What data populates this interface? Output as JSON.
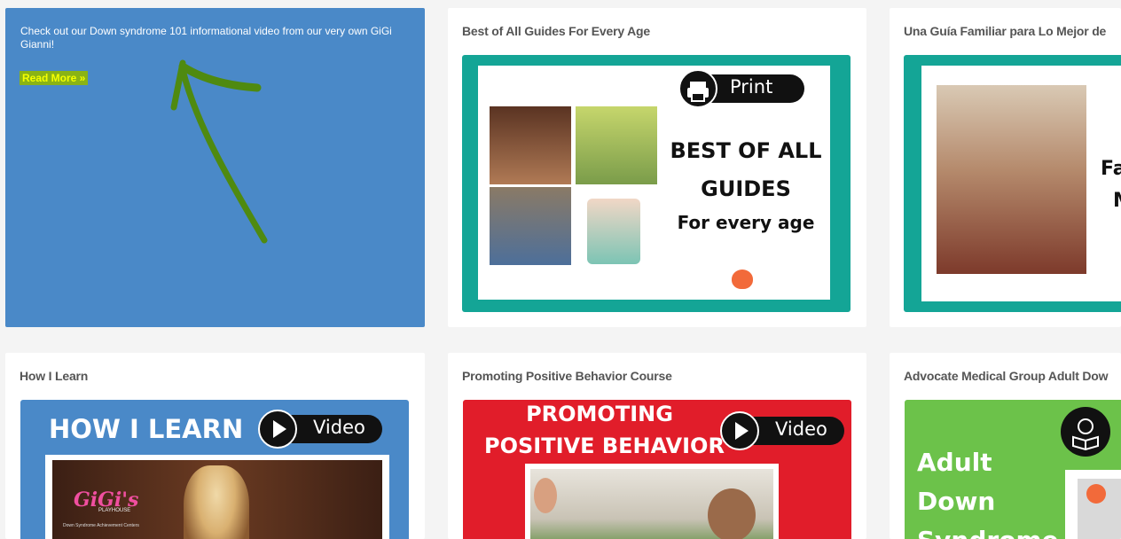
{
  "promo_card": {
    "text": "Check out our Down syndrome 101 informational video from our very own GiGi Gianni!",
    "read_more": "Read More »",
    "background": "#4a89c8",
    "highlight": "#ccff00"
  },
  "cards": [
    {
      "title": "Best of All Guides For Every Age",
      "thumb": {
        "badge": "Print",
        "line1": "BEST OF ALL",
        "line2": "GUIDES",
        "line3": "For every age",
        "frame_color": "#14a596"
      }
    },
    {
      "title": "Una Guía Familiar para Lo Mejor de",
      "thumb": {
        "partial1": "Fa",
        "partial2": "M",
        "frame_color": "#14a596"
      }
    },
    {
      "title": "How I Learn",
      "thumb": {
        "heading": "HOW I LEARN",
        "badge": "Video",
        "logo": "GiGi's",
        "logo_sub": "PLAYHOUSE",
        "logo_caption": "Down Syndrome Achievement Centers",
        "bg": "#4a89c8"
      }
    },
    {
      "title": "Promoting Positive Behavior Course",
      "thumb": {
        "line1": "PROMOTING",
        "line2": "POSITIVE BEHAVIOR",
        "badge": "Video",
        "bg": "#e11d2a"
      }
    },
    {
      "title": "Advocate Medical Group Adult Dow",
      "thumb": {
        "line1": "Adult",
        "line2": "Down",
        "line3": "Syndrome",
        "bg": "#6cc24a"
      }
    }
  ]
}
